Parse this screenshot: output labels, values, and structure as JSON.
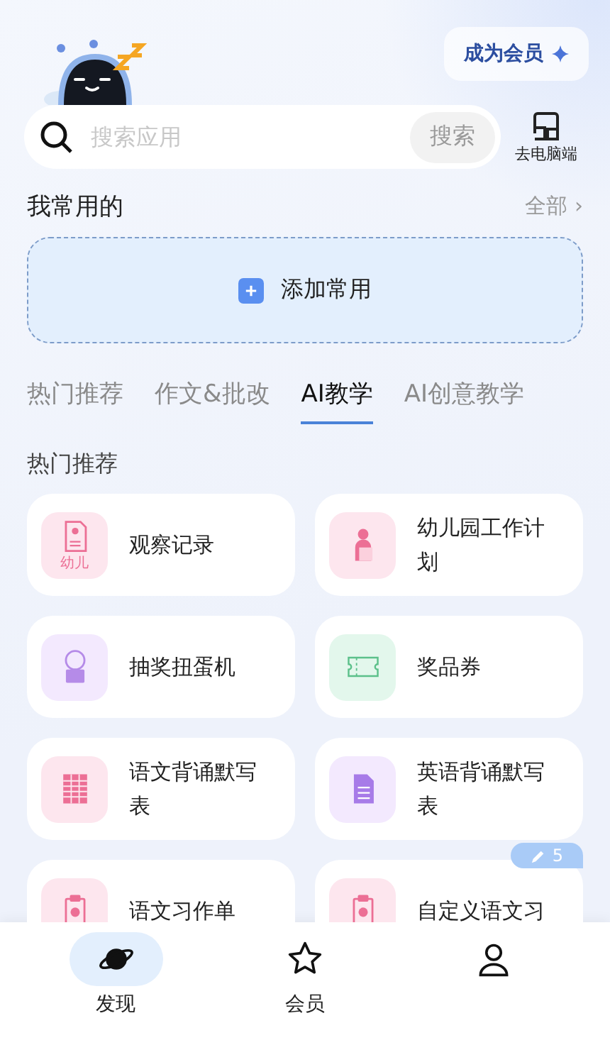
{
  "header": {
    "member_button": "成为会员",
    "search": {
      "placeholder": "搜索应用",
      "button": "搜索"
    },
    "pc_link": "去电脑端"
  },
  "favorites": {
    "title": "我常用的",
    "more": "全部",
    "more_arrow": "›",
    "add_label": "添加常用"
  },
  "tabs": [
    {
      "label": "热门推荐",
      "selected": false
    },
    {
      "label": "作文&批改",
      "selected": false
    },
    {
      "label": "AI教学",
      "selected": true
    },
    {
      "label": "AI创意教学",
      "selected": false
    }
  ],
  "section_title": "热门推荐",
  "apps": [
    {
      "name": "观察记录",
      "kind": "record",
      "icon_caption": "幼儿"
    },
    {
      "name": "幼儿园工作计划",
      "kind": "person"
    },
    {
      "name": "抽奖扭蛋机",
      "kind": "gacha"
    },
    {
      "name": "奖品券",
      "kind": "ticket"
    },
    {
      "name": "语文背诵默写表",
      "kind": "table"
    },
    {
      "name": "英语背诵默写表",
      "kind": "doc"
    },
    {
      "name": "语文习作单",
      "kind": "clipboard"
    },
    {
      "name": "自定义语文习",
      "kind": "clipboard",
      "badge": "5"
    }
  ],
  "nav": [
    {
      "label": "发现",
      "kind": "planet",
      "selected": true
    },
    {
      "label": "会员",
      "kind": "star",
      "selected": false
    },
    {
      "kind": "person",
      "selected": false
    }
  ]
}
